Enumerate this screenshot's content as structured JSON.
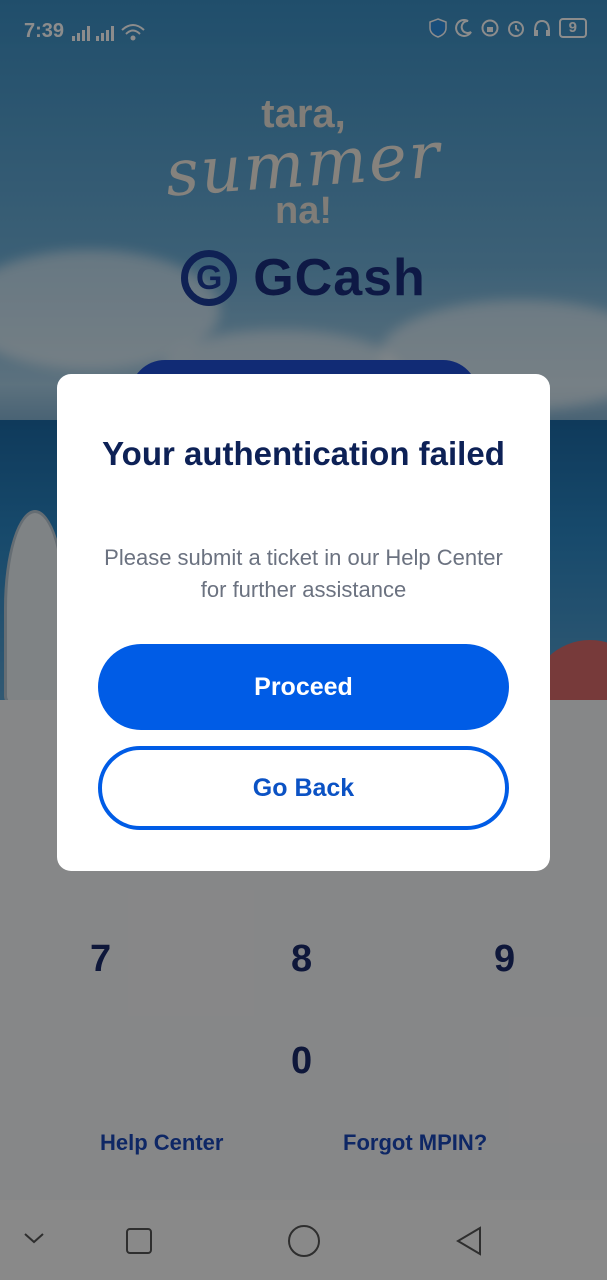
{
  "status_bar": {
    "time": "7:39",
    "battery": "9"
  },
  "promo": {
    "line1": "tara,",
    "line2": "summer",
    "line3": "na!"
  },
  "brand": {
    "logo_letter": "G",
    "name": "GCash"
  },
  "keypad": {
    "keys": [
      "7",
      "8",
      "9",
      "0"
    ]
  },
  "links": {
    "help_center": "Help Center",
    "forgot_mpin": "Forgot MPIN?"
  },
  "dialog": {
    "title": "Your authentication failed",
    "message": "Please submit a ticket in our Help Center for further assistance",
    "primary_label": "Proceed",
    "secondary_label": "Go Back"
  },
  "colors": {
    "accent": "#005ce6",
    "title": "#0d2156",
    "link": "#1b48b8"
  },
  "icons": [
    "shield-icon",
    "moon-icon",
    "alarm-icon",
    "headset-icon",
    "wifi-icon",
    "signal-icon",
    "back-nav-icon",
    "home-nav-icon",
    "recents-nav-icon",
    "collapse-nav-icon"
  ]
}
